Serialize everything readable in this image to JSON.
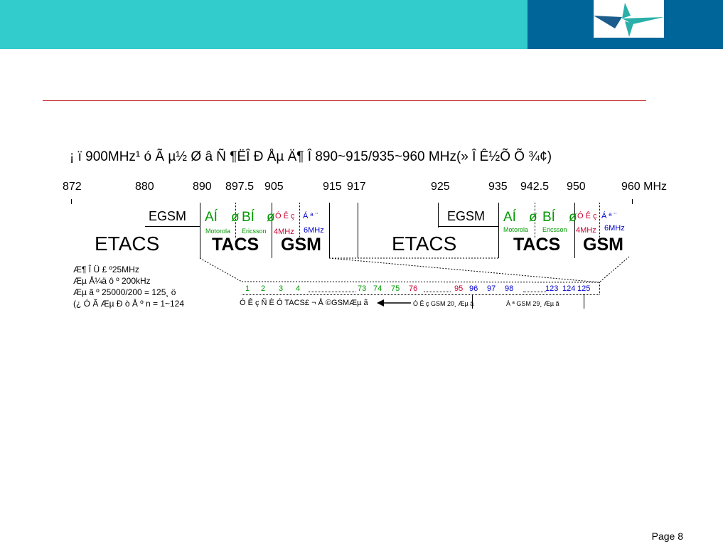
{
  "header": {
    "logo_icon": "compass-logo-icon",
    "teal": "#33cccc",
    "blue": "#006699"
  },
  "title": "¡ ï  900MHz¹  ó Ã  µ½ Ø â  Ñ ¶ËÎ  Ð  Åµ Ä¶  Î  890~915/935~960 MHz(»  Î  Ê½Õ  Õ ¾¢)",
  "freq_labels": [
    "872",
    "880",
    "890",
    "897.5",
    "905",
    "915",
    "917",
    "925",
    "935",
    "942.5",
    "950",
    "960 MHz"
  ],
  "bands": {
    "left": {
      "egsm": "EGSM",
      "a": "AÍ",
      "a_sep": "ø",
      "b": "BÍ",
      "b_sep": "ø",
      "mobile": "Ó Ê  ç",
      "unicom": "Á ª  ¨",
      "motorola": "Motorola",
      "ericsson": "Ericsson",
      "mhz4": "4MHz",
      "mhz6": "6MHz",
      "etacs": "ETACS",
      "tacs": "TACS",
      "gsm": "GSM"
    },
    "right": {
      "egsm": "EGSM",
      "a": "AÍ",
      "a_sep": "ø",
      "b": "BÍ",
      "b_sep": "ø",
      "mobile": "Ó Ê  ç",
      "unicom": "Á ª  ¨",
      "motorola": "Motorola",
      "ericsson": "Ericsson",
      "mhz4": "4MHz",
      "mhz6": "6MHz",
      "etacs": "ETACS",
      "tacs": "TACS",
      "gsm": "GSM"
    }
  },
  "notes": [
    "Æ¶ Î  Ü  £ º25MHz",
    "Æµ Å¼ä  ô  º   200kHz",
    "Æµ  ã  º 25000/200 = 125¸ ö",
    "(¿ Ó Ã Æµ  Ð  ò  Å  º n = 1~124"
  ],
  "channels": {
    "g1": [
      "1",
      "2",
      "3",
      "4"
    ],
    "g2": [
      "73",
      "74",
      "75"
    ],
    "g3": [
      "76"
    ],
    "g4": [
      "95"
    ],
    "g5": [
      "96",
      "97",
      "98"
    ],
    "g6": [
      "123",
      "124",
      "125"
    ]
  },
  "sub_labels": {
    "tacs_gsm": "Ó Ê  ç  Ñ  È  Ó TACS£ ¬ Å  ©GSMÆµ  ã",
    "mobile_gsm20": "Ó Ê  ç GSM 20¸ Æµ  ã",
    "unicom_gsm29": "Á ª  GSM 29¸ Æµ  ã"
  },
  "footer": {
    "page": "Page 8"
  }
}
